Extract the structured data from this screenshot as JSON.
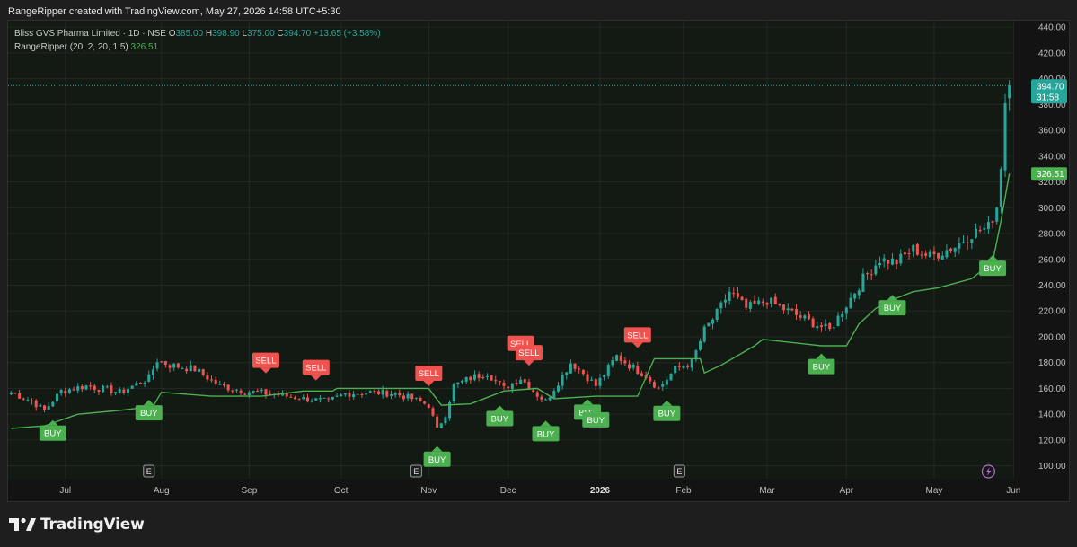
{
  "header": {
    "caption": "RangeRipper created with TradingView.com, May 27, 2026 14:58 UTC+5:30"
  },
  "legend": {
    "symbol": "Bliss GVS Pharma Limited · 1D · NSE",
    "o_label": "O",
    "o_value": "385.00",
    "h_label": "H",
    "h_value": "398.90",
    "l_label": "L",
    "l_value": "375.00",
    "c_label": "C",
    "c_value": "394.70",
    "change": "+13.65 (+3.58%)",
    "indicator_name": "RangeRipper",
    "indicator_params": "(20, 2, 20, 1.5)",
    "indicator_value": "326.51"
  },
  "footer": {
    "brand": "TradingView"
  },
  "colors": {
    "up": "#26a69a",
    "down": "#ef5350",
    "line": "#4caf50",
    "buy": "#4caf50",
    "sell": "#ef5350",
    "grid": "#262626",
    "axis_text": "#bdbdbd"
  },
  "chart_data": {
    "type": "candlestick",
    "y_axis": {
      "range": [
        90,
        445
      ],
      "ticks": [
        "100.00",
        "120.00",
        "140.00",
        "160.00",
        "180.00",
        "200.00",
        "220.00",
        "240.00",
        "260.00",
        "280.00",
        "300.00",
        "320.00",
        "340.00",
        "360.00",
        "380.00",
        "400.00",
        "420.00",
        "440.00"
      ]
    },
    "x_axis": {
      "ticks": [
        {
          "label": "Jul",
          "i": 13,
          "bold": false
        },
        {
          "label": "Aug",
          "i": 36,
          "bold": false
        },
        {
          "label": "Sep",
          "i": 57,
          "bold": false
        },
        {
          "label": "Oct",
          "i": 79,
          "bold": false
        },
        {
          "label": "Nov",
          "i": 100,
          "bold": false
        },
        {
          "label": "Dec",
          "i": 119,
          "bold": false
        },
        {
          "label": "2026",
          "i": 141,
          "bold": true
        },
        {
          "label": "Feb",
          "i": 161,
          "bold": false
        },
        {
          "label": "Mar",
          "i": 181,
          "bold": false
        },
        {
          "label": "Apr",
          "i": 200,
          "bold": false
        },
        {
          "label": "May",
          "i": 221,
          "bold": false
        },
        {
          "label": "Jun",
          "i": 240,
          "bold": false
        }
      ]
    },
    "anchors": [
      [
        0,
        157
      ],
      [
        5,
        150
      ],
      [
        8,
        143
      ],
      [
        12,
        158
      ],
      [
        18,
        162
      ],
      [
        26,
        157
      ],
      [
        33,
        168
      ],
      [
        35,
        182
      ],
      [
        38,
        178
      ],
      [
        44,
        175
      ],
      [
        50,
        162
      ],
      [
        56,
        158
      ],
      [
        64,
        155
      ],
      [
        70,
        152
      ],
      [
        76,
        150
      ],
      [
        80,
        156
      ],
      [
        86,
        157
      ],
      [
        92,
        156
      ],
      [
        96,
        152
      ],
      [
        100,
        147
      ],
      [
        102,
        128
      ],
      [
        104,
        140
      ],
      [
        106,
        162
      ],
      [
        110,
        168
      ],
      [
        114,
        172
      ],
      [
        118,
        160
      ],
      [
        122,
        168
      ],
      [
        126,
        155
      ],
      [
        128,
        150
      ],
      [
        131,
        165
      ],
      [
        134,
        180
      ],
      [
        136,
        175
      ],
      [
        140,
        162
      ],
      [
        145,
        185
      ],
      [
        148,
        178
      ],
      [
        152,
        170
      ],
      [
        155,
        160
      ],
      [
        159,
        175
      ],
      [
        163,
        180
      ],
      [
        166,
        205
      ],
      [
        169,
        218
      ],
      [
        172,
        235
      ],
      [
        176,
        222
      ],
      [
        181,
        228
      ],
      [
        186,
        220
      ],
      [
        191,
        212
      ],
      [
        196,
        205
      ],
      [
        200,
        225
      ],
      [
        204,
        245
      ],
      [
        208,
        260
      ],
      [
        212,
        258
      ],
      [
        216,
        268
      ],
      [
        220,
        262
      ],
      [
        226,
        270
      ],
      [
        230,
        280
      ],
      [
        234,
        285
      ],
      [
        236,
        300
      ],
      [
        237,
        330
      ],
      [
        238,
        381
      ],
      [
        239,
        394.7
      ]
    ],
    "last_candle": {
      "open": 385.0,
      "high": 398.9,
      "low": 375.0,
      "close": 394.7
    },
    "indicator": {
      "name": "RangeRipper",
      "params": "(20, 2, 20, 1.5)",
      "points": [
        [
          0,
          129
        ],
        [
          8,
          131
        ],
        [
          16,
          140
        ],
        [
          26,
          143
        ],
        [
          34,
          146
        ],
        [
          36,
          157
        ],
        [
          48,
          154
        ],
        [
          60,
          154
        ],
        [
          70,
          158
        ],
        [
          77,
          158
        ],
        [
          78,
          160
        ],
        [
          100,
          160
        ],
        [
          103,
          147
        ],
        [
          110,
          148
        ],
        [
          118,
          158
        ],
        [
          126,
          160
        ],
        [
          130,
          152
        ],
        [
          140,
          154
        ],
        [
          150,
          154
        ],
        [
          154,
          183
        ],
        [
          160,
          183
        ],
        [
          165,
          183
        ],
        [
          166,
          172
        ],
        [
          170,
          178
        ],
        [
          178,
          193
        ],
        [
          180,
          198
        ],
        [
          194,
          193
        ],
        [
          200,
          193
        ],
        [
          203,
          210
        ],
        [
          207,
          222
        ],
        [
          212,
          230
        ],
        [
          216,
          235
        ],
        [
          222,
          238
        ],
        [
          230,
          245
        ],
        [
          235,
          258
        ],
        [
          237,
          290
        ],
        [
          239,
          326.51
        ]
      ],
      "last": 326.51
    },
    "signals": [
      {
        "type": "BUY",
        "i": 10
      },
      {
        "type": "BUY",
        "i": 33
      },
      {
        "type": "SELL",
        "i": 61
      },
      {
        "type": "SELL",
        "i": 73
      },
      {
        "type": "SELL",
        "i": 100
      },
      {
        "type": "BUY",
        "i": 102
      },
      {
        "type": "BUY",
        "i": 117
      },
      {
        "type": "SELL",
        "i": 122
      },
      {
        "type": "SELL",
        "i": 124
      },
      {
        "type": "BUY",
        "i": 128
      },
      {
        "type": "BUY",
        "i": 138
      },
      {
        "type": "BUY",
        "i": 140
      },
      {
        "type": "SELL",
        "i": 150
      },
      {
        "type": "BUY",
        "i": 157
      },
      {
        "type": "BUY",
        "i": 194
      },
      {
        "type": "BUY",
        "i": 211
      },
      {
        "type": "BUY",
        "i": 235
      }
    ],
    "earnings_markers": [
      {
        "label": "E",
        "i": 33
      },
      {
        "label": "E",
        "i": 97
      },
      {
        "label": "E",
        "i": 160
      }
    ],
    "price_labels": [
      {
        "kind": "price",
        "value": 394.7,
        "text": "394.70",
        "sub": "31:58"
      },
      {
        "kind": "indicator",
        "value": 326.51,
        "text": "326.51"
      }
    ]
  }
}
